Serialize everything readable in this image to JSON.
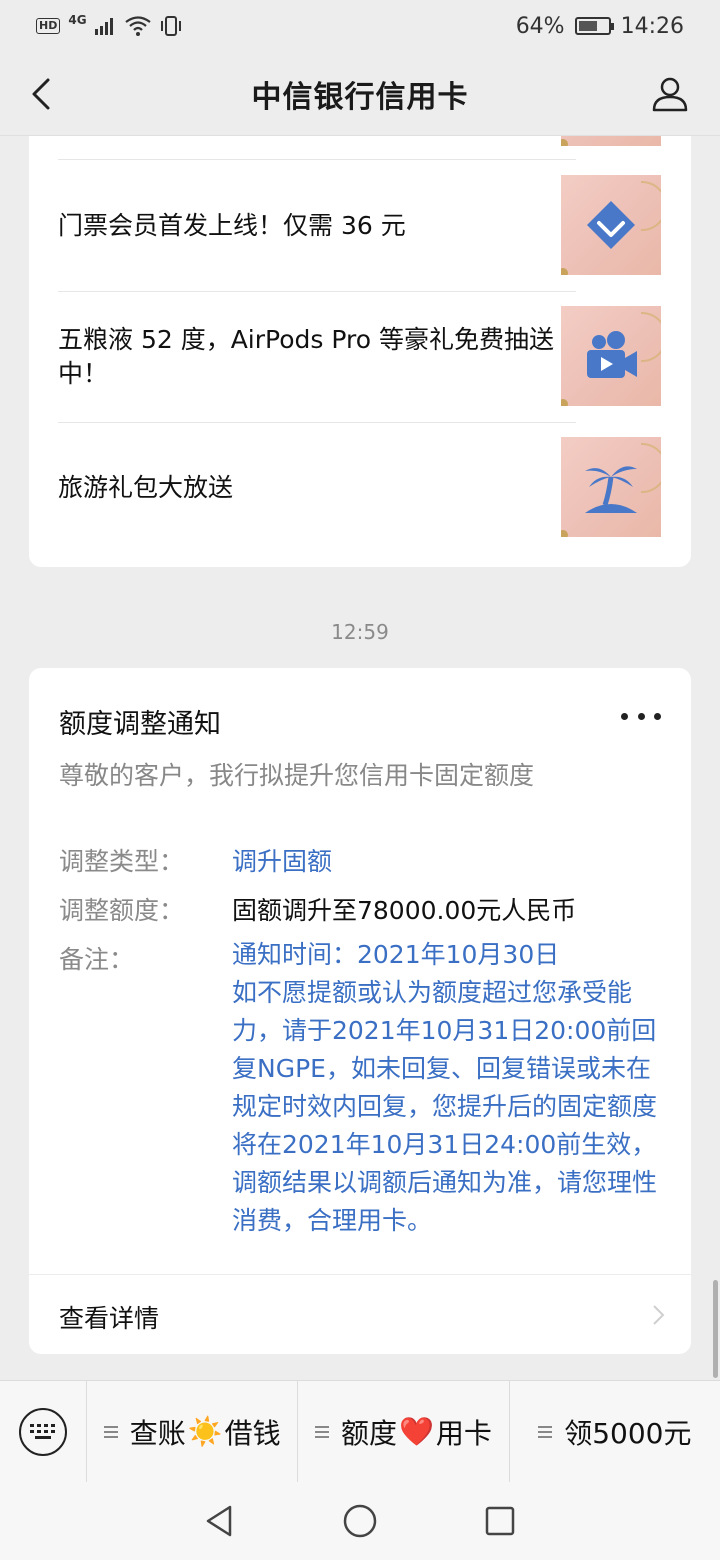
{
  "status_bar": {
    "hd": "HD",
    "network": "4G",
    "battery_percent": "64%",
    "battery_level": 0.64,
    "time": "14:26"
  },
  "nav": {
    "title": "中信银行信用卡"
  },
  "articles": [
    {
      "title": "门票会员首发上线！仅需 36 元",
      "icon": "diamond-icon"
    },
    {
      "title": "五粮液 52 度，AirPods Pro 等豪礼免费抽送中！",
      "icon": "video-camera-icon"
    },
    {
      "title": "旅游礼包大放送",
      "icon": "palm-tree-icon"
    }
  ],
  "timestamp": "12:59",
  "notice": {
    "title": "额度调整通知",
    "subtitle": "尊敬的客户，我行拟提升您信用卡固定额度",
    "rows": [
      {
        "label": "调整类型：",
        "value": "调升固额"
      },
      {
        "label": "调整额度：",
        "value": "固额调升至78000.00元人民币"
      },
      {
        "label": "备注：",
        "value": "通知时间：2021年10月30日\n如不愿提额或认为额度超过您承受能力，请于2021年10月31日20:00前回复NGPE，如未回复、回复错误或未在规定时效内回复，您提升后的固定额度将在2021年10月31日24:00前生效，调额结果以调额后通知为准，请您理性消费，合理用卡。"
      }
    ],
    "detail_label": "查看详情"
  },
  "menu": {
    "items": [
      {
        "left": "查账",
        "emoji": "☀️",
        "right": "借钱"
      },
      {
        "left": "额度",
        "emoji": "❤️",
        "right": "用卡"
      },
      {
        "left": "领5000元",
        "emoji": "",
        "right": ""
      }
    ]
  },
  "colors": {
    "link_blue": "#3a6fc4",
    "icon_blue": "#4a78c8",
    "thumb_bg": "#efc4b8"
  }
}
